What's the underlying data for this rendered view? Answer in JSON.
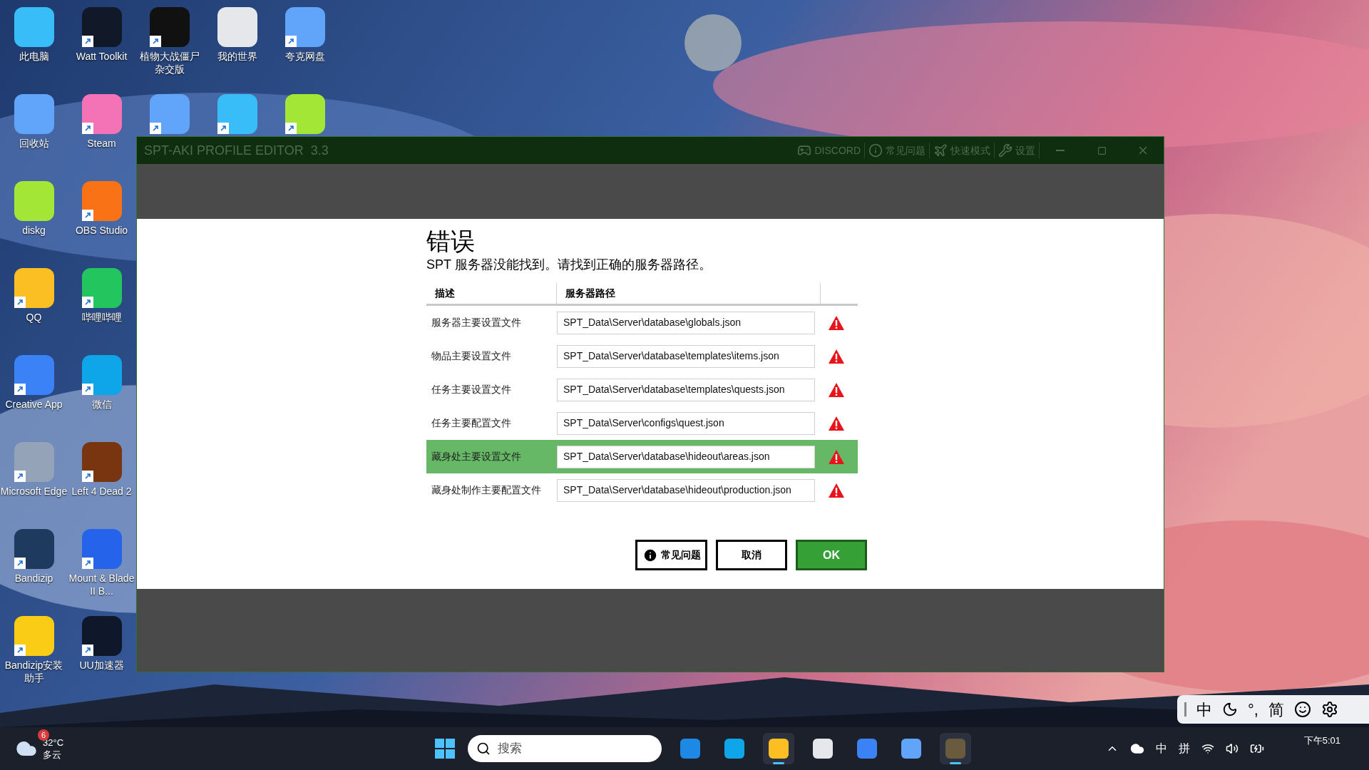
{
  "desktop": {
    "columns": [
      [
        {
          "label": "此电脑",
          "shortcut": false
        },
        {
          "label": "回收站",
          "shortcut": false
        },
        {
          "label": "diskg",
          "shortcut": false
        },
        {
          "label": "QQ",
          "shortcut": true
        },
        {
          "label": "Creative App",
          "shortcut": true
        },
        {
          "label": "Microsoft Edge",
          "shortcut": true
        },
        {
          "label": "Bandizip",
          "shortcut": true
        },
        {
          "label": "Bandizip安装助手",
          "shortcut": true
        }
      ],
      [
        {
          "label": "Watt Toolkit",
          "shortcut": true
        },
        {
          "label": "Steam",
          "shortcut": true
        },
        {
          "label": "OBS Studio",
          "shortcut": true
        },
        {
          "label": "哔哩哔哩",
          "shortcut": true
        },
        {
          "label": "微信",
          "shortcut": true
        },
        {
          "label": "Left 4 Dead 2",
          "shortcut": true
        },
        {
          "label": "Mount & Blade II B...",
          "shortcut": true
        },
        {
          "label": "UU加速器",
          "shortcut": true
        }
      ],
      [
        {
          "label": "植物大战僵尸杂交版",
          "shortcut": true
        },
        {
          "shortcut": true
        }
      ],
      [
        {
          "label": "我的世界",
          "shortcut": false
        },
        {
          "shortcut": true
        }
      ],
      [
        {
          "label": "夸克网盘",
          "shortcut": true
        },
        {
          "shortcut": true
        }
      ]
    ]
  },
  "window": {
    "title": "SPT-AKI PROFILE EDITOR  3.3",
    "toolbar": [
      "DISCORD",
      "常见问题",
      "快速模式",
      "设置"
    ]
  },
  "dialog": {
    "title": "错误",
    "message": "SPT 服务器没能找到。请找到正确的服务器路径。",
    "columns": [
      "描述",
      "服务器路径"
    ],
    "rows": [
      {
        "description": "服务器主要设置文件",
        "path": "SPT_Data\\Server\\database\\globals.json",
        "selected": false,
        "warning": true
      },
      {
        "description": "物品主要设置文件",
        "path": "SPT_Data\\Server\\database\\templates\\items.json",
        "selected": false,
        "warning": true
      },
      {
        "description": "任务主要设置文件",
        "path": "SPT_Data\\Server\\database\\templates\\quests.json",
        "selected": false,
        "warning": true
      },
      {
        "description": "任务主要配置文件",
        "path": "SPT_Data\\Server\\configs\\quest.json",
        "selected": false,
        "warning": true
      },
      {
        "description": "藏身处主要设置文件",
        "path": "SPT_Data\\Server\\database\\hideout\\areas.json",
        "selected": true,
        "warning": true
      },
      {
        "description": "藏身处制作主要配置文件",
        "path": "SPT_Data\\Server\\database\\hideout\\production.json",
        "selected": false,
        "warning": true
      }
    ],
    "buttons": [
      {
        "label": "常见问题",
        "kind": "help"
      },
      {
        "label": "取消",
        "kind": "plain"
      },
      {
        "label": "OK",
        "kind": "primary"
      }
    ]
  },
  "ime_bar": {
    "mode": "中",
    "punctuation": "°,",
    "script": "简"
  },
  "taskbar": {
    "weather": {
      "badge": "6",
      "temperature": "32°C",
      "condition": "多云"
    },
    "search": {
      "placeholder": "搜索"
    },
    "apps": [
      {
        "selected": false
      },
      {
        "selected": false
      },
      {
        "selected": true
      },
      {
        "selected": false
      },
      {
        "selected": false
      },
      {
        "selected": false
      },
      {
        "selected": true
      }
    ],
    "tray": {
      "input": "中",
      "ime": "拼",
      "time": "下午5:01"
    }
  }
}
